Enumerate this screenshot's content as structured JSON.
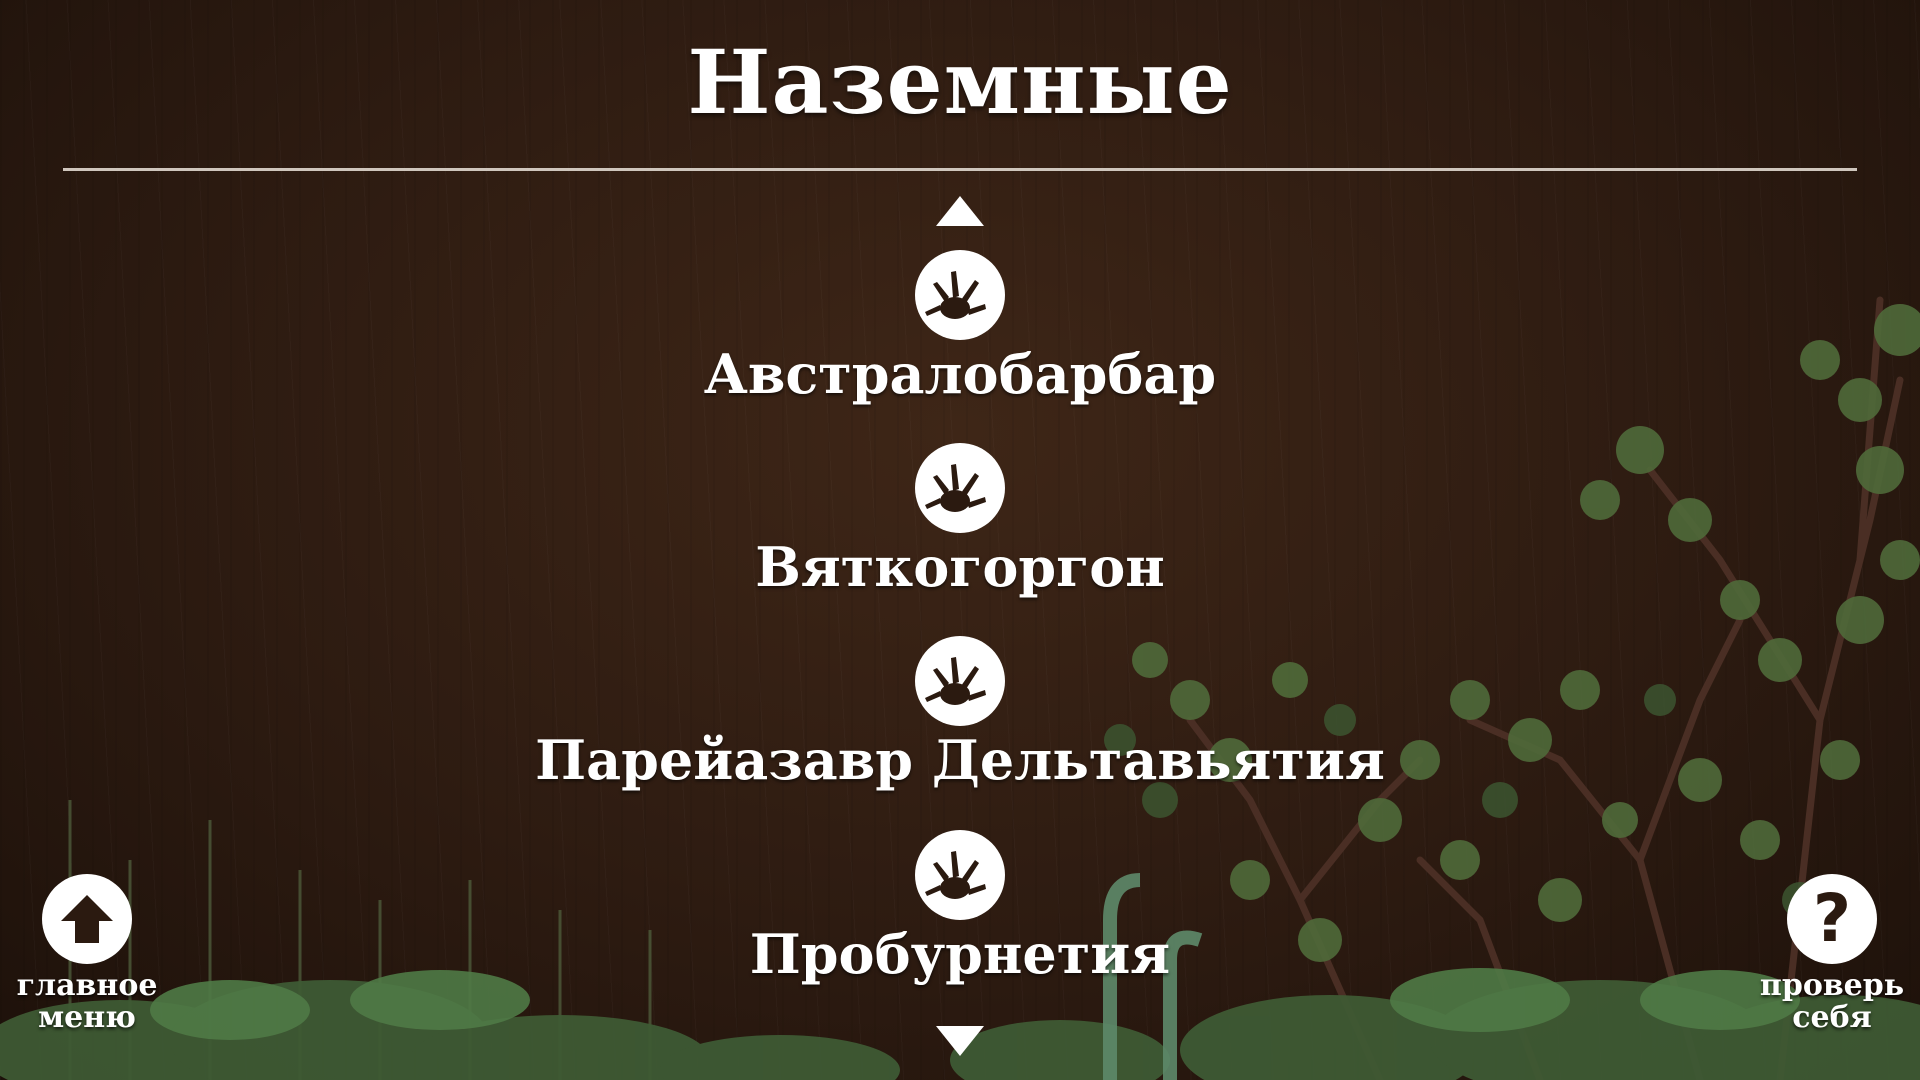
{
  "header": {
    "title": "Наземные"
  },
  "navigation": {
    "scroll_up_icon": "triangle-up-icon",
    "scroll_down_icon": "triangle-down-icon"
  },
  "animals": [
    {
      "name": "Австралобарбар",
      "icon": "footprint-icon"
    },
    {
      "name": "Вяткогоргон",
      "icon": "footprint-icon"
    },
    {
      "name": "Парейазавр Дельтавьятия",
      "icon": "footprint-icon"
    },
    {
      "name": "Пробурнетия",
      "icon": "footprint-icon"
    }
  ],
  "footer": {
    "home": {
      "icon": "home-icon",
      "line1": "главное",
      "line2": "меню"
    },
    "quiz": {
      "icon": "question-mark-icon",
      "glyph": "?",
      "line1": "проверь",
      "line2": "себя"
    }
  },
  "colors": {
    "background": "#2d1b11",
    "text": "#ffffff",
    "divider": "#cfc6bd",
    "icon_dark": "#2b1a10",
    "foliage": "#4f6a3a"
  }
}
